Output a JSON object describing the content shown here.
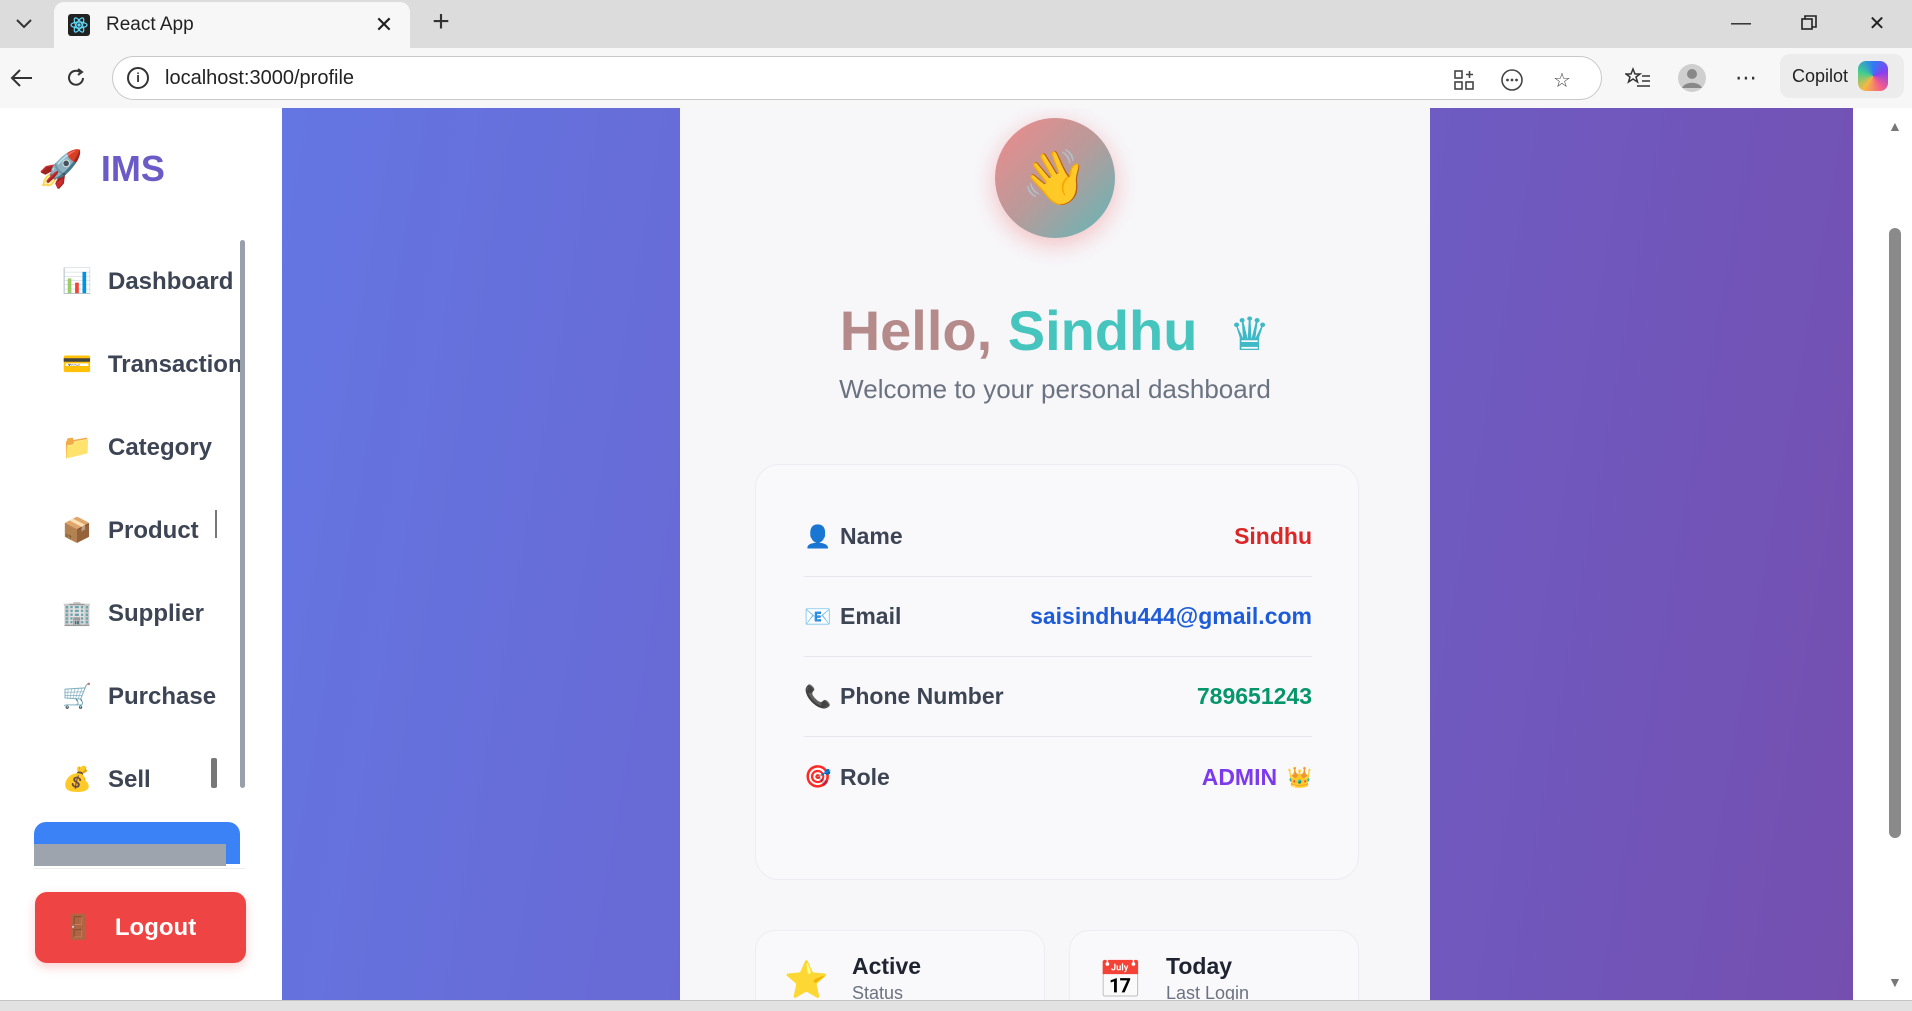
{
  "browser": {
    "tab_title": "React App",
    "url": "localhost:3000/profile",
    "copilot_label": "Copilot"
  },
  "sidebar": {
    "brand_icon": "🚀",
    "brand_name": "IMS",
    "items": [
      {
        "icon": "📊",
        "label": "Dashboard"
      },
      {
        "icon": "💳",
        "label": "Transaction"
      },
      {
        "icon": "📁",
        "label": "Category"
      },
      {
        "icon": "📦",
        "label": "Product"
      },
      {
        "icon": "🏢",
        "label": "Supplier"
      },
      {
        "icon": "🛒",
        "label": "Purchase"
      },
      {
        "icon": "💰",
        "label": "Sell"
      }
    ],
    "logout_icon": "🚪",
    "logout_label": "Logout"
  },
  "profile": {
    "avatar_emoji": "👋",
    "greeting_hello": "Hello,",
    "greeting_name": "Sindhu",
    "greeting_crown": "♛",
    "welcome": "Welcome to your personal dashboard",
    "fields": [
      {
        "icon": "👤",
        "label": "Name",
        "value": "Sindhu",
        "color": "#dc2626"
      },
      {
        "icon": "📧",
        "label": "Email",
        "value": "saisindhu444@gmail.com",
        "color": "#1d5bd8"
      },
      {
        "icon": "📞",
        "label": "Phone Number",
        "value": "789651243",
        "color": "#059669"
      },
      {
        "icon": "🎯",
        "label": "Role",
        "value": "ADMIN",
        "color": "#7c3aed",
        "suffix": "👑"
      }
    ],
    "stats": [
      {
        "icon": "⭐",
        "title": "Active",
        "subtitle": "Status"
      },
      {
        "icon": "📅",
        "title": "Today",
        "subtitle": "Last Login"
      }
    ]
  },
  "colors": {
    "brand": "#6b5bc6",
    "logout": "#ef4444",
    "gradient_start": "#6476e2",
    "gradient_end": "#744fb0"
  }
}
